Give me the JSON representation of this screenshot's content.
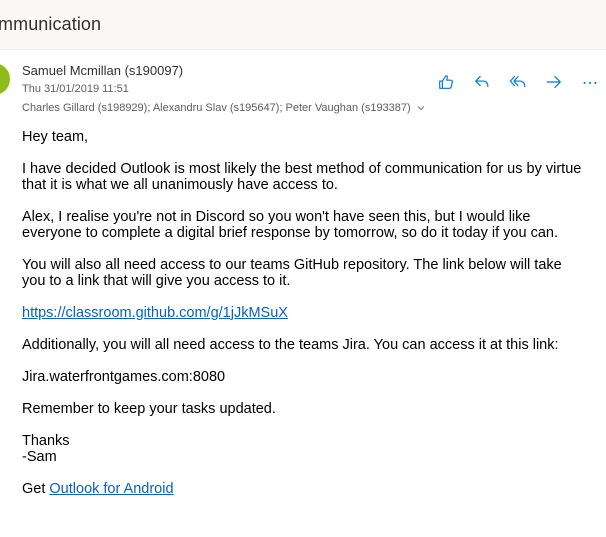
{
  "header": {
    "subject": "mmunication"
  },
  "message": {
    "sender": "Samuel Mcmillan (s190097)",
    "date": "Thu 31/01/2019 11:51",
    "recipients": "Charles Gillard (s198929); Alexandru Slav (s195647); Peter Vaughan (s193387)",
    "avatar_color": "#8cbd18",
    "actions": [
      "like-icon",
      "reply-icon",
      "reply-all-icon",
      "forward-icon",
      "more-icon"
    ]
  },
  "body": {
    "greeting": "Hey team,",
    "p1_line1": "I have decided Outlook is most likely the best method of communication for us by virtue",
    "p1_line2": "that it is what we all unanimously have access to.",
    "p2_line1": "Alex, I realise you're not in Discord so you won't have seen this, but I would like",
    "p2_line2": "everyone to complete a digital brief response by tomorrow, so do it today if you can.",
    "p3_line1": "You will also all need access to our teams GitHub repository. The link below will take",
    "p3_line2": "you to a link that will give you access to it.",
    "github_link": "https://classroom.github.com/g/1jJkMSuX",
    "p4": "Additionally, you will all need access to the teams Jira. You can access it at this link:",
    "jira": "Jira.waterfrontgames.com:8080",
    "p5": "Remember to keep your tasks updated.",
    "thanks": "Thanks",
    "signature": "-Sam",
    "get_prefix": "Get ",
    "android_link": "Outlook for Android"
  },
  "colors": {
    "accent": "#0078d4",
    "link": "#0563c1"
  }
}
